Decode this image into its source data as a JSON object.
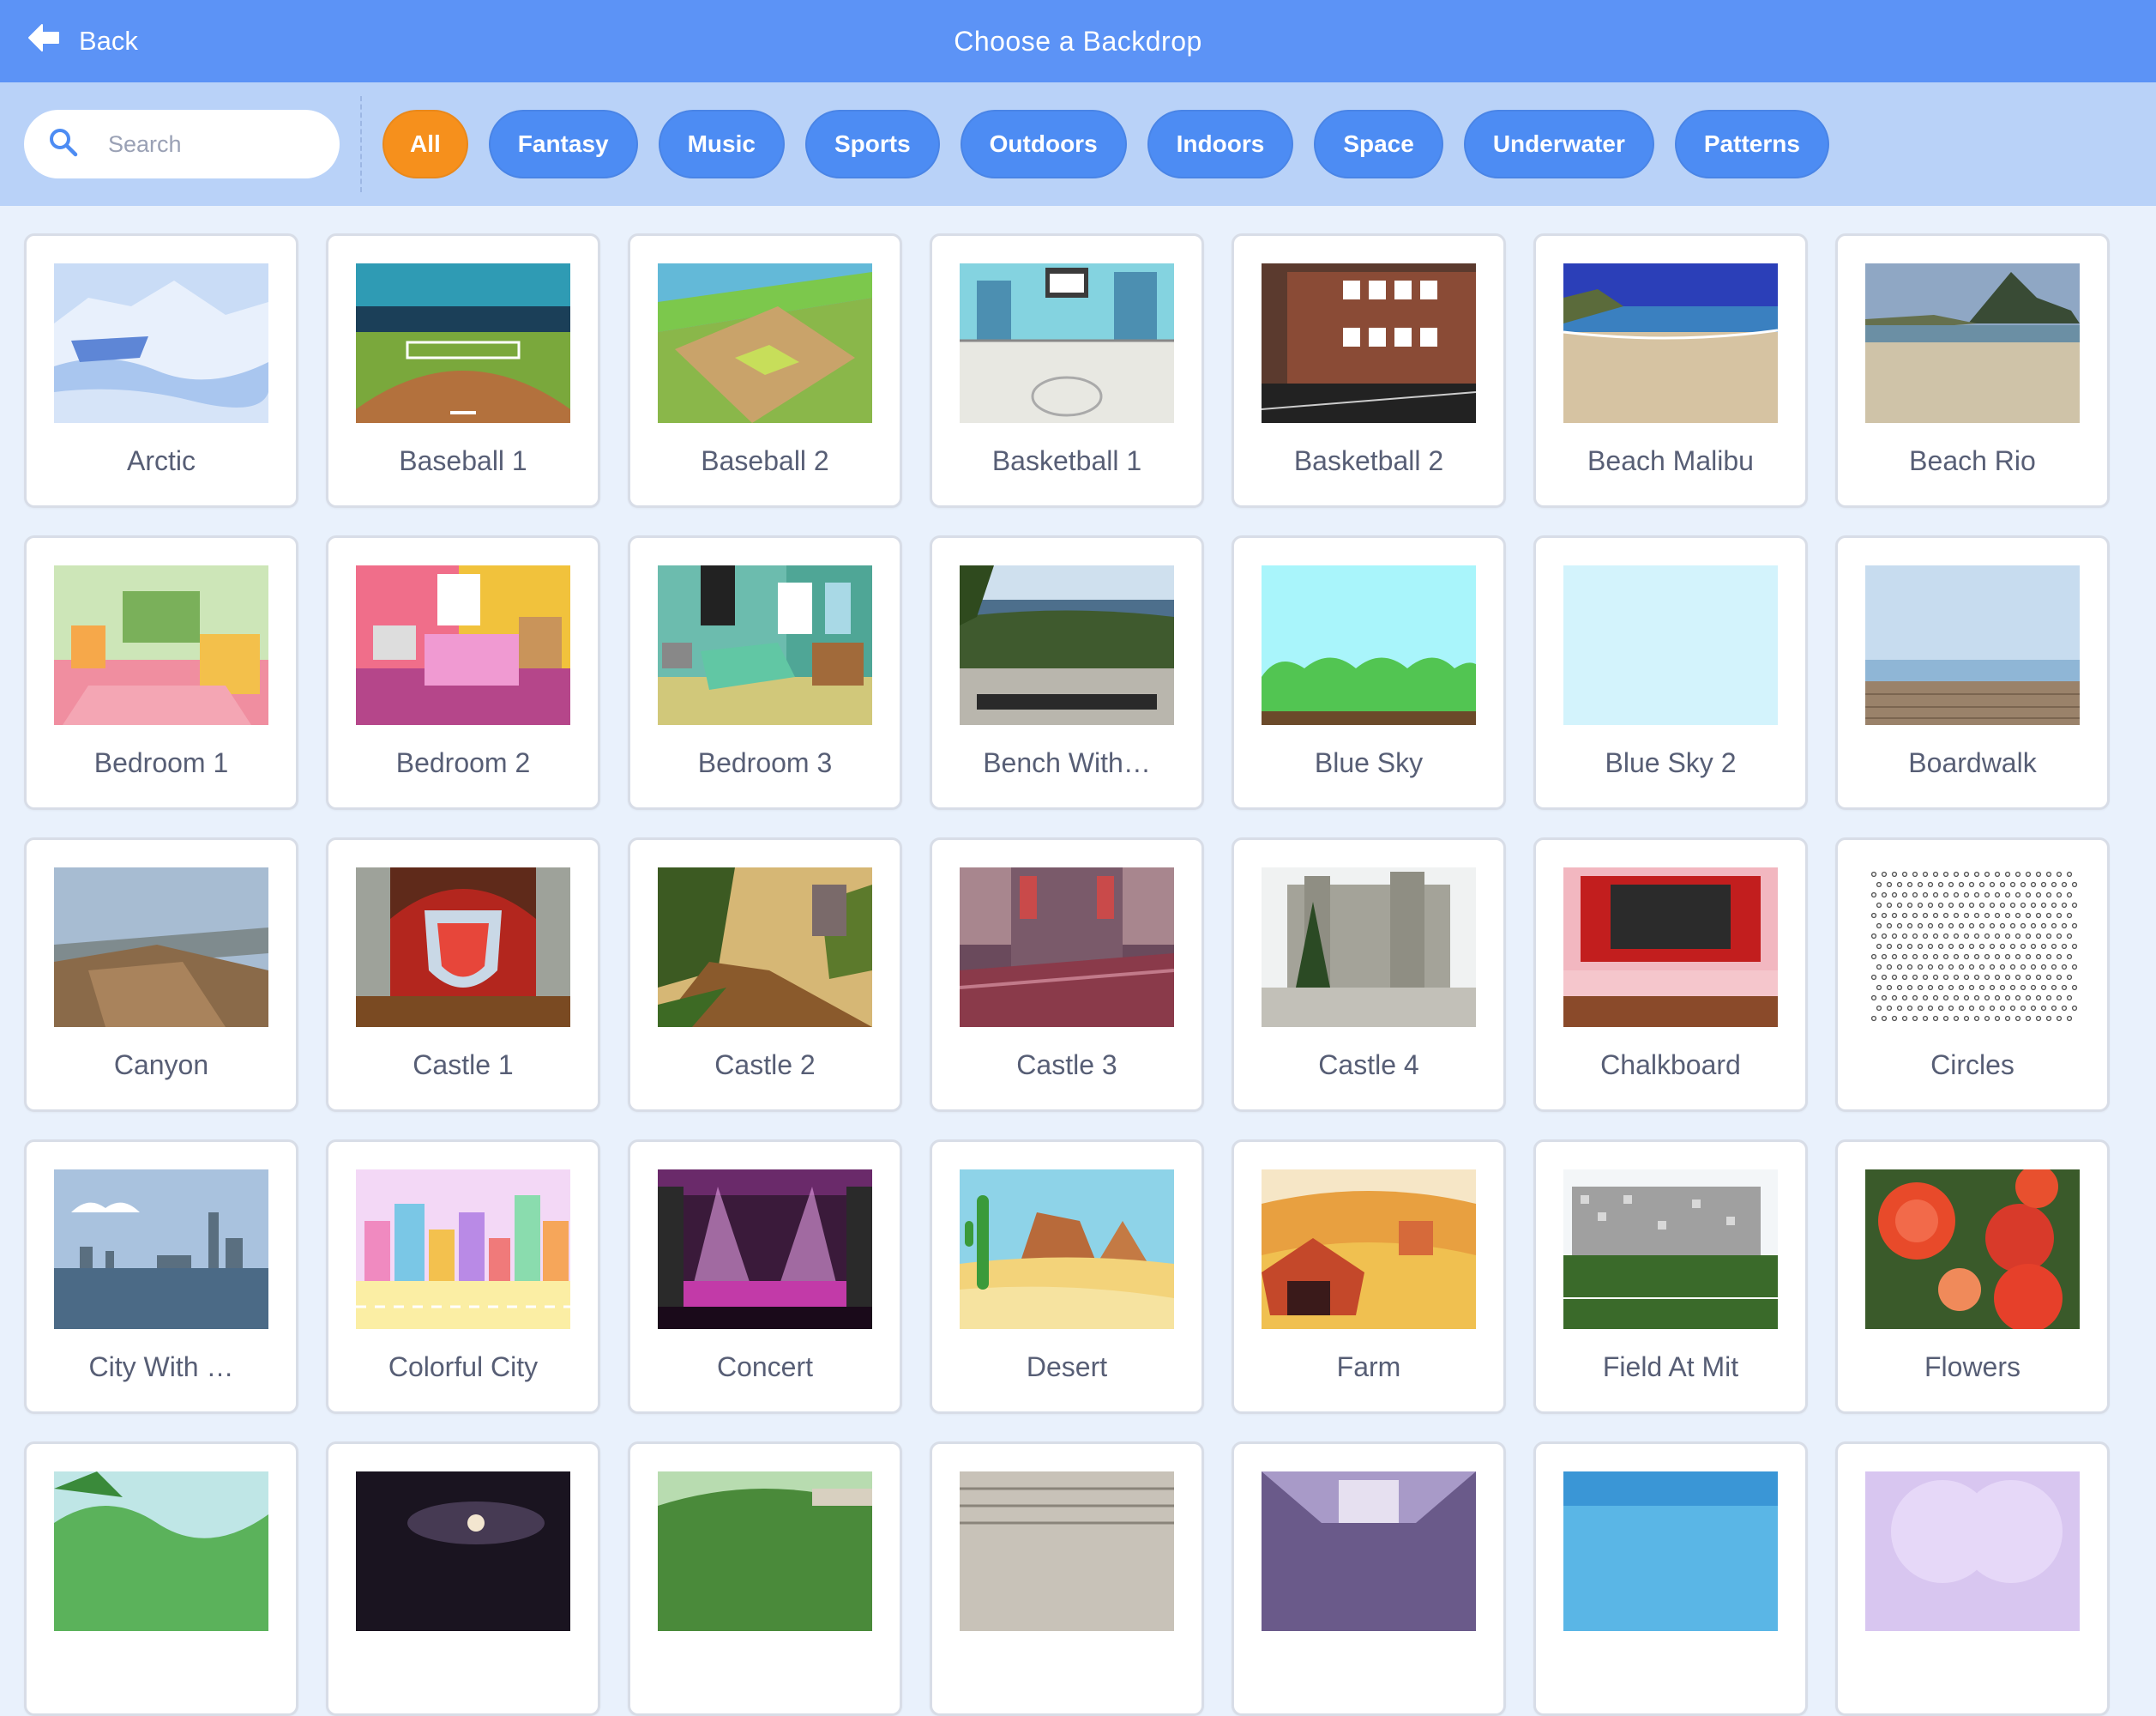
{
  "header": {
    "back_label": "Back",
    "title": "Choose a Backdrop"
  },
  "search": {
    "placeholder": "Search",
    "value": ""
  },
  "tags": [
    {
      "label": "All",
      "active": true
    },
    {
      "label": "Fantasy",
      "active": false
    },
    {
      "label": "Music",
      "active": false
    },
    {
      "label": "Sports",
      "active": false
    },
    {
      "label": "Outdoors",
      "active": false
    },
    {
      "label": "Indoors",
      "active": false
    },
    {
      "label": "Space",
      "active": false
    },
    {
      "label": "Underwater",
      "active": false
    },
    {
      "label": "Patterns",
      "active": false
    }
  ],
  "colors": {
    "header": "#5c93f6",
    "filter_bar": "#b9d2f8",
    "tag": "#4d8cf3",
    "tag_active": "#f6901c",
    "background": "#e9f1fc"
  },
  "backdrops": [
    {
      "name": "Arctic",
      "art": "arctic"
    },
    {
      "name": "Baseball 1",
      "art": "baseball1"
    },
    {
      "name": "Baseball 2",
      "art": "baseball2"
    },
    {
      "name": "Basketball 1",
      "art": "basketball1"
    },
    {
      "name": "Basketball 2",
      "art": "basketball2"
    },
    {
      "name": "Beach Malibu",
      "art": "beachmalibu"
    },
    {
      "name": "Beach Rio",
      "art": "beachrio"
    },
    {
      "name": "Bedroom 1",
      "art": "bedroom1"
    },
    {
      "name": "Bedroom 2",
      "art": "bedroom2"
    },
    {
      "name": "Bedroom 3",
      "art": "bedroom3"
    },
    {
      "name": "Bench With…",
      "art": "bench"
    },
    {
      "name": "Blue Sky",
      "art": "bluesky"
    },
    {
      "name": "Blue Sky 2",
      "art": "bluesky2"
    },
    {
      "name": "Boardwalk",
      "art": "boardwalk"
    },
    {
      "name": "Canyon",
      "art": "canyon"
    },
    {
      "name": "Castle 1",
      "art": "castle1"
    },
    {
      "name": "Castle 2",
      "art": "castle2"
    },
    {
      "name": "Castle 3",
      "art": "castle3"
    },
    {
      "name": "Castle 4",
      "art": "castle4"
    },
    {
      "name": "Chalkboard",
      "art": "chalkboard"
    },
    {
      "name": "Circles",
      "art": "circles"
    },
    {
      "name": "City With …",
      "art": "city"
    },
    {
      "name": "Colorful City",
      "art": "colorfulcity"
    },
    {
      "name": "Concert",
      "art": "concert"
    },
    {
      "name": "Desert",
      "art": "desert"
    },
    {
      "name": "Farm",
      "art": "farm"
    },
    {
      "name": "Field At Mit",
      "art": "field"
    },
    {
      "name": "Flowers",
      "art": "flowers"
    },
    {
      "name": "",
      "art": "forest"
    },
    {
      "name": "",
      "art": "galaxy"
    },
    {
      "name": "",
      "art": "garden"
    },
    {
      "name": "",
      "art": "stairs"
    },
    {
      "name": "",
      "art": "hallway"
    },
    {
      "name": "",
      "art": "sky3"
    },
    {
      "name": "",
      "art": "hearts"
    }
  ]
}
